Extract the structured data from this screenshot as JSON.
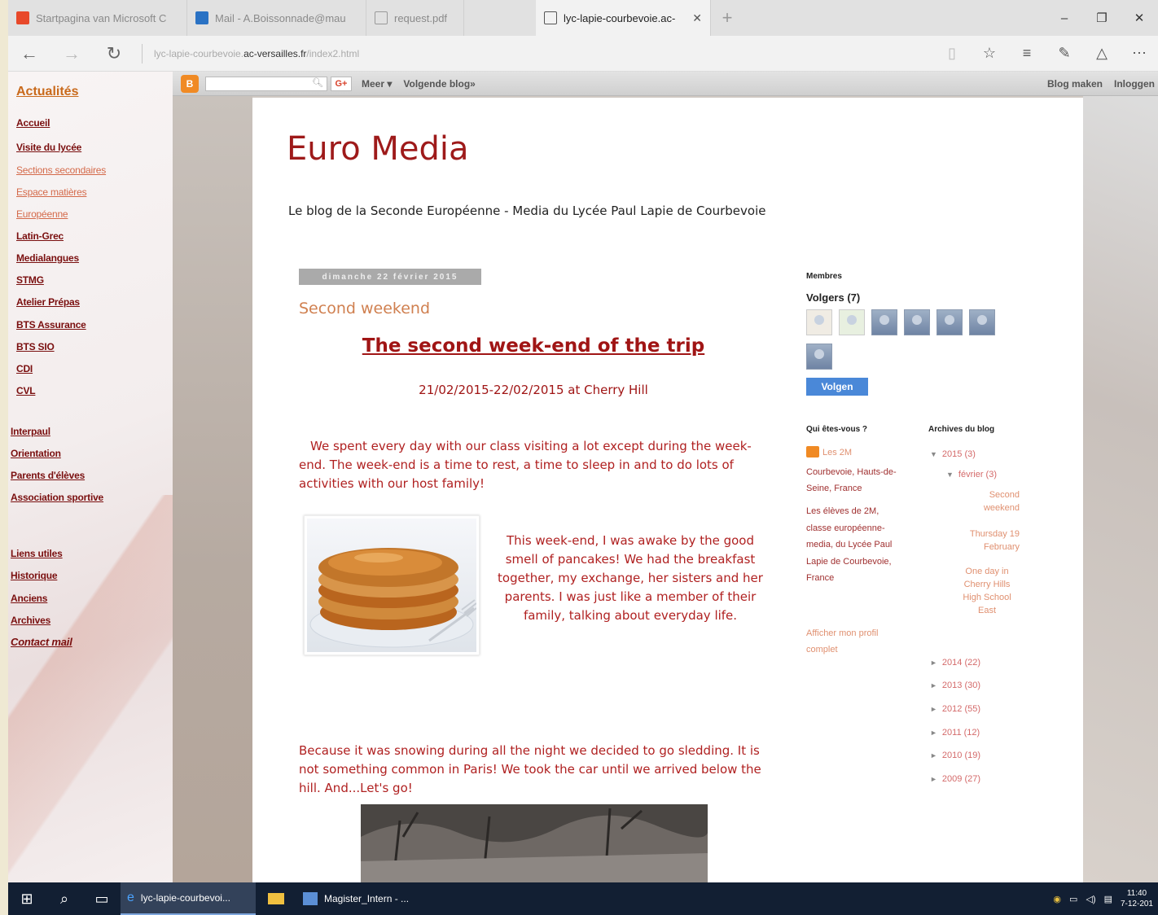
{
  "browser": {
    "tabs": [
      {
        "label": "Startpagina van Microsoft C",
        "active": false
      },
      {
        "label": "Mail - A.Boissonnade@mau",
        "active": false
      },
      {
        "label": "request.pdf",
        "active": false
      },
      {
        "label": "lyc-lapie-courbevoie.ac-",
        "active": true
      }
    ],
    "new_tab": "+",
    "window_controls": {
      "minimize": "–",
      "restore": "❐",
      "close": "✕"
    },
    "url_prefix": "lyc-lapie-courbevoie.",
    "url_host": "ac-versailles.fr",
    "url_path": "/index2.html"
  },
  "leftnav": {
    "title": "Actualités",
    "items": [
      {
        "label": "Accueil"
      },
      {
        "label": "Visite du lycée"
      },
      {
        "label": "Sections secondaires"
      },
      {
        "label": "Espace matières"
      },
      {
        "label": "Européenne"
      },
      {
        "label": "Latin-Grec"
      },
      {
        "label": "Medialangues"
      },
      {
        "label": "STMG"
      },
      {
        "label": "Atelier Prépas"
      },
      {
        "label": "BTS Assurance"
      },
      {
        "label": "BTS SIO"
      },
      {
        "label": "CDI"
      },
      {
        "label": "CVL"
      },
      {
        "label": "Interpaul"
      },
      {
        "label": "Orientation"
      },
      {
        "label": "Parents d'élèves"
      },
      {
        "label": "Association sportive"
      },
      {
        "label": "Liens utiles"
      },
      {
        "label": "Historique"
      },
      {
        "label": "Anciens"
      },
      {
        "label": "Archives"
      },
      {
        "label": "Contact mail"
      }
    ]
  },
  "bloggerbar": {
    "google_button": "G+",
    "more": "Meer ▾",
    "next_blog": "Volgende blog»",
    "create_blog": "Blog maken",
    "sign_in": "Inloggen"
  },
  "blog": {
    "title": "Euro Media",
    "description": "Le blog de la Seconde Européenne - Media du Lycée Paul Lapie de Courbevoie",
    "date_header": "dimanche 22 février 2015",
    "post_title": "Second weekend",
    "heading": "The second week-end of the trip",
    "subheading": "21/02/2015-22/02/2015 at Cherry Hill",
    "para1": "We spent every day with our class visiting a lot except during the week-end. The week-end is a time to rest, a time to sleep in and to do lots of activities with our host family!",
    "para2": "This week-end, I was awake by the good smell of pancakes! We had the breakfast together, my exchange, her sisters and her parents. I was just like a member of their family, talking about everyday life.",
    "para3": "Because it was snowing during all the night we decided to go sledding. It is not something common in Paris! We took the car until we arrived below the hill.  And...Let's go!"
  },
  "sidebar": {
    "members_label": "Membres",
    "followers_label": "Volgers (7)",
    "follow_button": "Volgen",
    "about_label": "Qui êtes-vous ?",
    "profile_name": "Les 2M",
    "profile_location": "Courbevoie, Hauts-de-Seine, France",
    "profile_desc": "Les élèves de 2M, classe européenne-media, du Lycée Paul Lapie de Courbevoie, France",
    "profile_link": "Afficher mon profil complet",
    "archive_label": "Archives du blog",
    "archive_2015": "2015 (3)",
    "archive_feb": "février (3)",
    "archive_posts": [
      "Second weekend",
      "Thursday 19 February",
      "One day in Cherry Hills High School East"
    ],
    "archive_years": [
      "2014 (22)",
      "2013 (30)",
      "2012 (55)",
      "2011 (12)",
      "2010 (19)",
      "2009 (27)"
    ]
  },
  "taskbar": {
    "apps": [
      {
        "label": "lyc-lapie-courbevoi...",
        "active": true
      },
      {
        "label": "",
        "active": false
      },
      {
        "label": "Magister_Intern - ...",
        "active": false
      }
    ],
    "time": "11:40",
    "date": "7-12-201"
  }
}
